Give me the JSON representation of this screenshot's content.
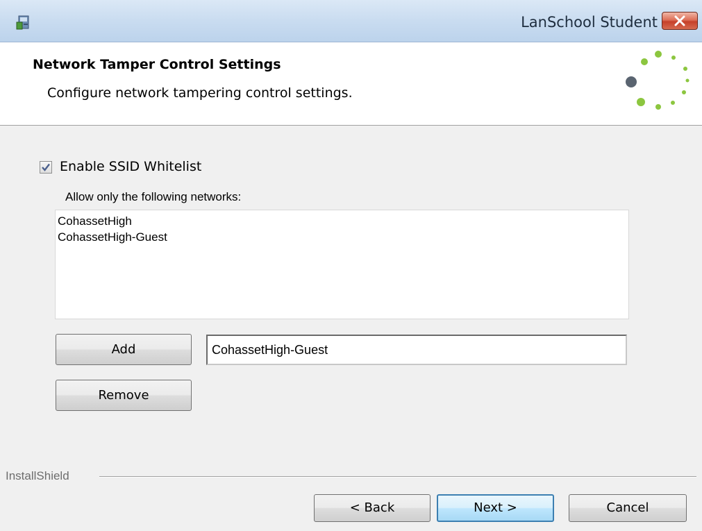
{
  "window": {
    "title": "LanSchool Student"
  },
  "header": {
    "title": "Network Tamper Control Settings",
    "subtitle": "Configure network tampering control settings."
  },
  "whitelist": {
    "checkbox_label": "Enable SSID Whitelist",
    "checked": true,
    "list_label": "Allow only the following networks:",
    "items": [
      "CohassetHigh",
      "CohassetHigh-Guest"
    ],
    "add_label": "Add",
    "remove_label": "Remove",
    "input_value": "CohassetHigh-Guest"
  },
  "footer": {
    "brand": "InstallShield",
    "back_label": "< Back",
    "next_label": "Next >",
    "cancel_label": "Cancel"
  },
  "icons": {
    "app": "installer-icon",
    "close": "close-icon",
    "spinner": "loading-spinner-icon",
    "check": "checkmark-icon"
  },
  "colors": {
    "spinner_green": "#8cc63f",
    "spinner_gray": "#5a6470",
    "close_red": "#c6402a",
    "next_border": "#3c7fb1"
  }
}
